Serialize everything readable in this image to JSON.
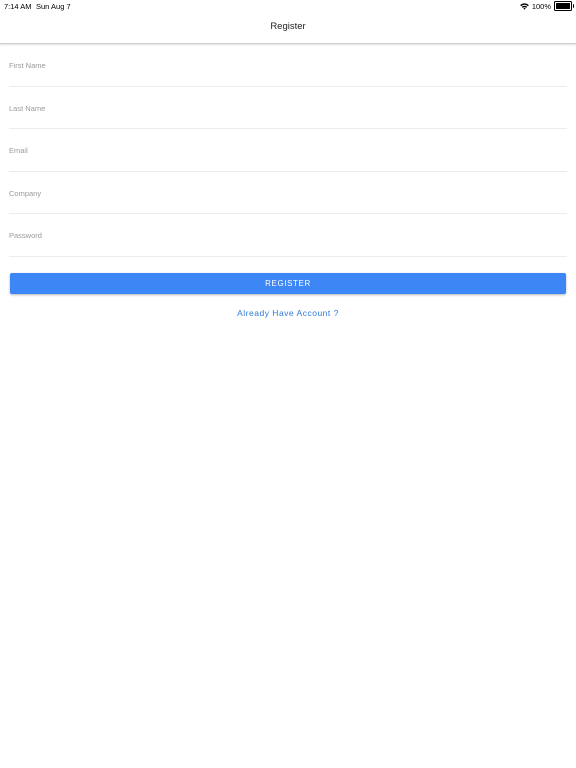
{
  "status_bar": {
    "time": "7:14 AM",
    "date": "Sun Aug 7",
    "battery": "100%",
    "battery_level": 1.0,
    "icons": [
      "wifi-icon",
      "battery-icon"
    ]
  },
  "nav": {
    "title": "Register"
  },
  "form": {
    "fields": [
      {
        "placeholder": "First Name",
        "value": ""
      },
      {
        "placeholder": "Last Name",
        "value": ""
      },
      {
        "placeholder": "Email",
        "value": ""
      },
      {
        "placeholder": "Company",
        "value": ""
      },
      {
        "placeholder": "Password",
        "value": ""
      }
    ],
    "register_label": "REGISTER",
    "login_link": "Already Have Account ?"
  },
  "colors": {
    "accent": "#3d86f6",
    "link": "#2f78d8",
    "placeholder": "#9a9a9a",
    "divider": "#ececec"
  }
}
